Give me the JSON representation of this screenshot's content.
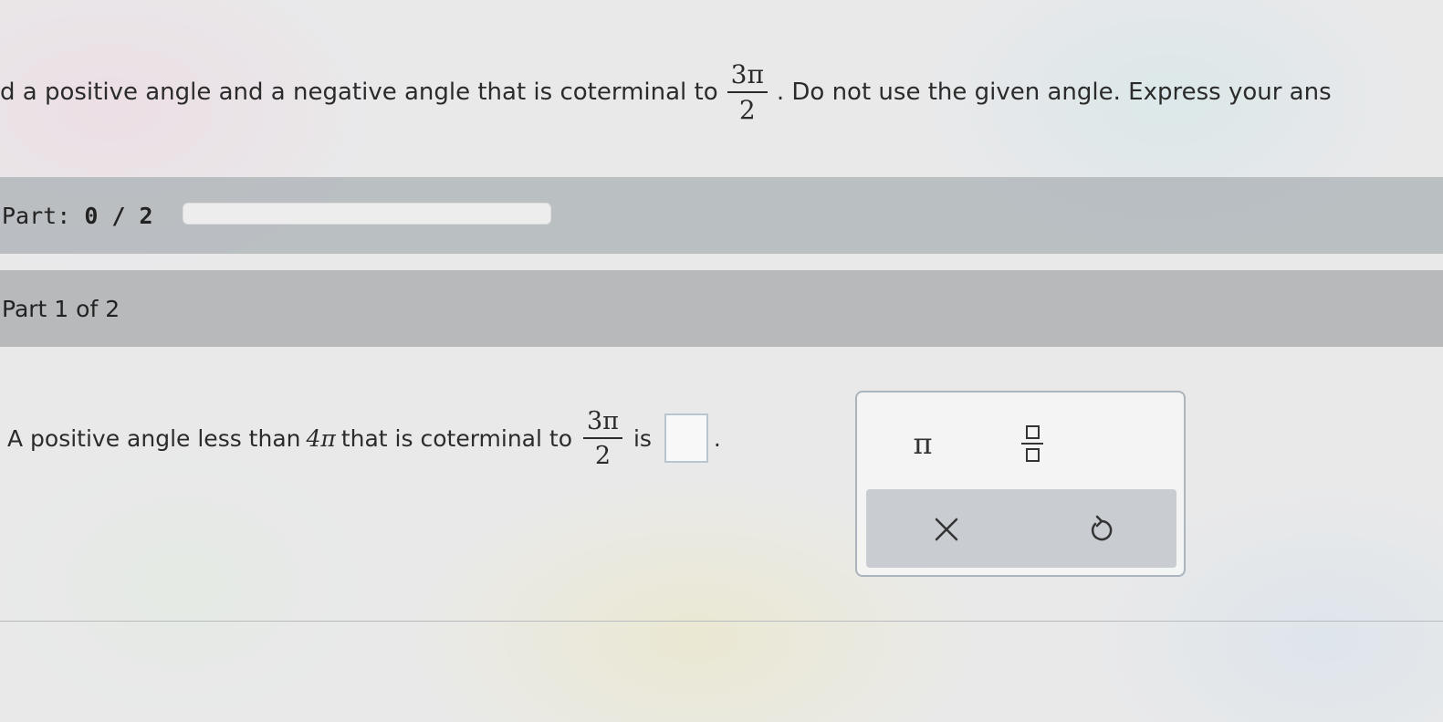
{
  "question": {
    "text_before": "d a positive angle and a negative angle that is coterminal to",
    "fraction": {
      "numerator": "3π",
      "denominator": "2"
    },
    "text_after": ". Do not use the given angle. Express your ans"
  },
  "progress": {
    "label": "Part:",
    "value": "0 / 2",
    "completed": 0,
    "total": 2,
    "fill_fraction": 0
  },
  "part": {
    "title": "Part 1 of 2"
  },
  "answer": {
    "text_before": "A positive angle less than",
    "four_pi": "4π",
    "text_middle": "that is coterminal to",
    "fraction": {
      "numerator": "3π",
      "denominator": "2"
    },
    "text_is": "is",
    "text_end": "."
  },
  "palette": {
    "pi_symbol": "π",
    "fraction_icon": "fraction-template-icon",
    "clear_icon": "close-icon",
    "undo_icon": "undo-icon"
  },
  "colors": {
    "accent": "#4a8fc7",
    "band": "#aab0b4",
    "palette_border": "#a9b4bd"
  }
}
